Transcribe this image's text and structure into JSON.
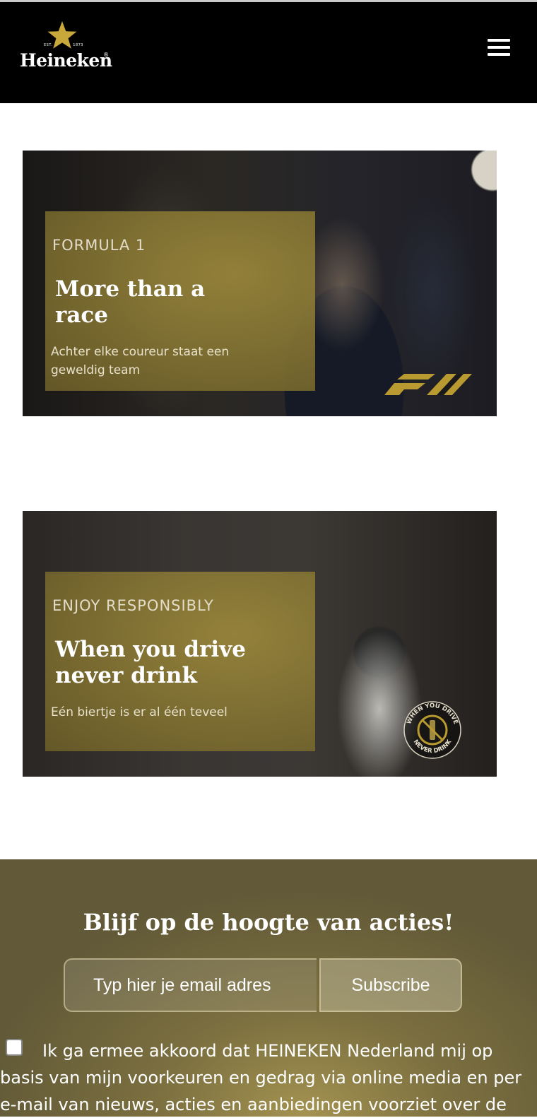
{
  "header": {
    "brand": "Heineken",
    "est_left": "EST.",
    "est_right": "1873",
    "reg_mark": "®"
  },
  "cards": [
    {
      "eyebrow": "FORMULA 1",
      "title": "More than a race",
      "description": "Achter elke coureur staat een geweldig team"
    },
    {
      "eyebrow": "ENJOY RESPONSIBLY",
      "title": "When you drive never drink",
      "description": "Eén biertje is er al één teveel",
      "badge_top": "WHEN YOU DRIVE",
      "badge_bottom": "NEVER DRINK"
    }
  ],
  "newsletter": {
    "heading": "Blijf op de hoogte van acties!",
    "email_placeholder": "Typ hier je email adres",
    "subscribe_label": "Subscribe",
    "consent_text": "Ik ga ermee akkoord dat HEINEKEN Nederland mij op basis van mijn voorkeuren en gedrag via online media en per e-mail van nieuws, acties en aanbiedingen voorziet over de"
  },
  "colors": {
    "header_bg": "#000000",
    "panel_gold": "#8c7a3a",
    "star_gold": "#c8a83a"
  },
  "icons": [
    "heineken-star-icon",
    "hamburger-menu-icon",
    "f1-logo-icon",
    "no-drink-driving-badge"
  ]
}
